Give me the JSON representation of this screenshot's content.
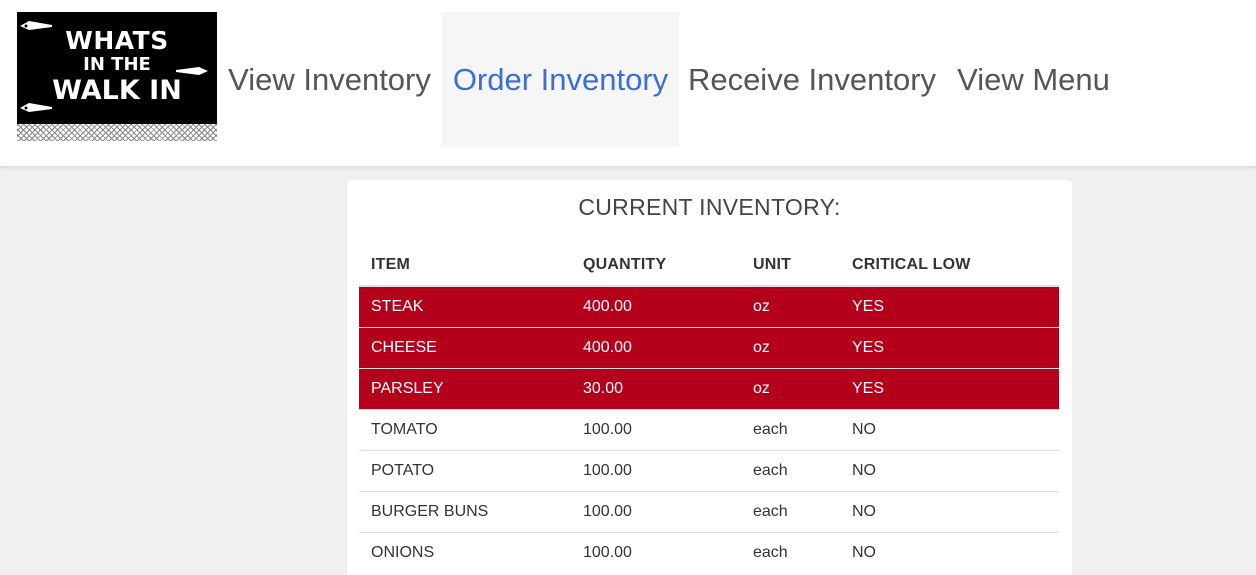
{
  "logo": {
    "line1": "WHATS",
    "line2": "IN THE",
    "line3": "WALK IN"
  },
  "nav": {
    "items": [
      {
        "label": "View Inventory",
        "active": false
      },
      {
        "label": "Order Inventory",
        "active": true
      },
      {
        "label": "Receive Inventory",
        "active": false
      },
      {
        "label": "View Menu",
        "active": false
      }
    ]
  },
  "colors": {
    "active_link": "#3a6fd8",
    "critical_row": "#b4001b",
    "page_bg": "#f0f0f0"
  },
  "inventory": {
    "title": "CURRENT INVENTORY:",
    "columns": [
      "ITEM",
      "QUANTITY",
      "UNIT",
      "CRITICAL LOW"
    ],
    "rows": [
      {
        "item": "STEAK",
        "quantity": "400.00",
        "unit": "oz",
        "critical": "YES"
      },
      {
        "item": "CHEESE",
        "quantity": "400.00",
        "unit": "oz",
        "critical": "YES"
      },
      {
        "item": "PARSLEY",
        "quantity": "30.00",
        "unit": "oz",
        "critical": "YES"
      },
      {
        "item": "TOMATO",
        "quantity": "100.00",
        "unit": "each",
        "critical": "NO"
      },
      {
        "item": "POTATO",
        "quantity": "100.00",
        "unit": "each",
        "critical": "NO"
      },
      {
        "item": "BURGER BUNS",
        "quantity": "100.00",
        "unit": "each",
        "critical": "NO"
      },
      {
        "item": "ONIONS",
        "quantity": "100.00",
        "unit": "each",
        "critical": "NO"
      }
    ]
  }
}
